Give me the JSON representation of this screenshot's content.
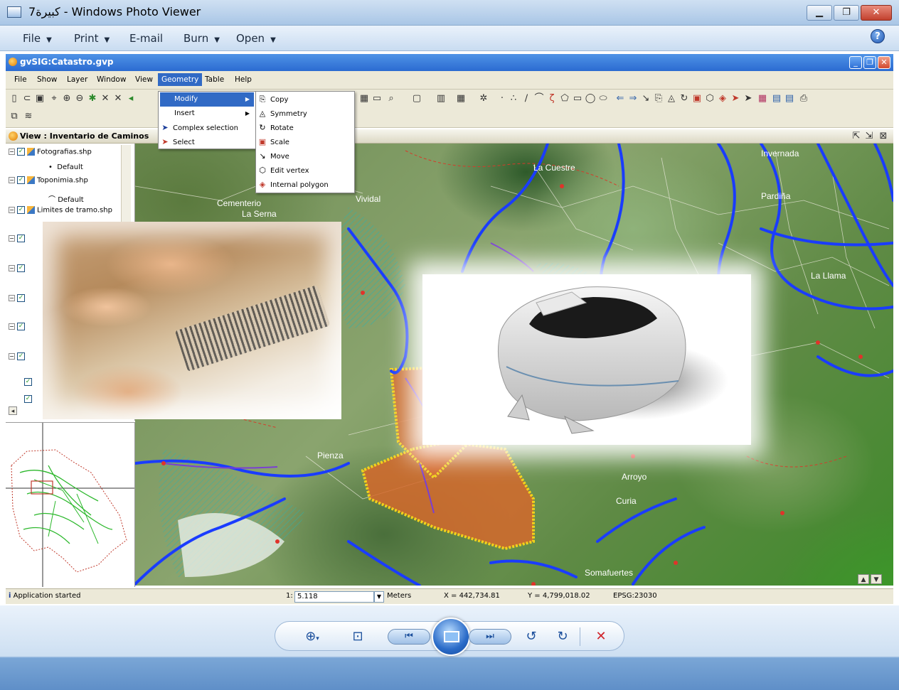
{
  "photo_viewer": {
    "title": "كبيرة7 - Windows Photo Viewer",
    "menu": [
      {
        "label": "File",
        "has_caret": true
      },
      {
        "label": "Print",
        "has_caret": true
      },
      {
        "label": "E-mail",
        "has_caret": false
      },
      {
        "label": "Burn",
        "has_caret": true
      },
      {
        "label": "Open",
        "has_caret": true
      }
    ],
    "help_icon": "?",
    "caption_icons": [
      "minimize-icon",
      "restore-icon",
      "close-icon"
    ]
  },
  "gvsig": {
    "title": "gvSIG:Catastro.gvp",
    "menu": [
      "File",
      "Show",
      "Layer",
      "Window",
      "View",
      "Geometry",
      "Table",
      "Help"
    ],
    "active_menu": "Geometry",
    "view_title": "View : Inventario de Caminos"
  },
  "geometry_menu": {
    "items": [
      {
        "label": "Modify",
        "submenu": true,
        "icon": ""
      },
      {
        "label": "Insert",
        "submenu": true,
        "icon": ""
      },
      {
        "label": "Complex selection",
        "submenu": false,
        "icon": "arrow-cursor-icon"
      },
      {
        "label": "Select",
        "submenu": false,
        "icon": "arrow-cursor-icon"
      }
    ]
  },
  "modify_submenu": {
    "items": [
      {
        "label": "Copy",
        "icon": "copy-icon"
      },
      {
        "label": "Symmetry",
        "icon": "symmetry-icon"
      },
      {
        "label": "Rotate",
        "icon": "rotate-icon"
      },
      {
        "label": "Scale",
        "icon": "scale-icon"
      },
      {
        "label": "Move",
        "icon": "move-icon"
      },
      {
        "label": "Edit vertex",
        "icon": "edit-vertex-icon"
      },
      {
        "label": "Internal polygon",
        "icon": "internal-polygon-icon"
      }
    ]
  },
  "toc": {
    "layers": [
      {
        "name": "Fotografias.shp",
        "legend": "Default",
        "legend_symbol": "•"
      },
      {
        "name": "Toponimia.shp",
        "legend": "Default",
        "legend_symbol": "⌒"
      },
      {
        "name": "Limites de tramo.shp",
        "legend": "",
        "legend_symbol": ""
      }
    ]
  },
  "map_labels": [
    "La Cuestre",
    "Cementerio",
    "La Serna",
    "Vividal",
    "Pienza",
    "Arroyo",
    "Curia",
    "Somafuertes",
    "Invernada",
    "La Llama",
    "Pardiña"
  ],
  "statusbar": {
    "message": "Application started",
    "scale_prefix": "1:",
    "scale_value": "5.118",
    "units": "Meters",
    "x": "X = 442,734.81",
    "y": "Y = 4,799,018.02",
    "crs": "EPSG:23030"
  },
  "viewer_controls": [
    {
      "name": "zoom",
      "icon": "zoom-icon"
    },
    {
      "name": "fit",
      "icon": "fit-window-icon"
    },
    {
      "name": "previous",
      "icon": "previous-icon"
    },
    {
      "name": "slideshow",
      "icon": "slideshow-icon"
    },
    {
      "name": "next",
      "icon": "next-icon"
    },
    {
      "name": "rotate_ccw",
      "icon": "rotate-ccw-icon"
    },
    {
      "name": "rotate_cw",
      "icon": "rotate-cw-icon"
    },
    {
      "name": "delete",
      "icon": "delete-icon"
    }
  ],
  "colors": {
    "menu_highlight": "#316ac5",
    "road_blue": "#1a3cff",
    "parcel_orange": "#d5692b",
    "selection_yellow": "#f2d21b"
  }
}
